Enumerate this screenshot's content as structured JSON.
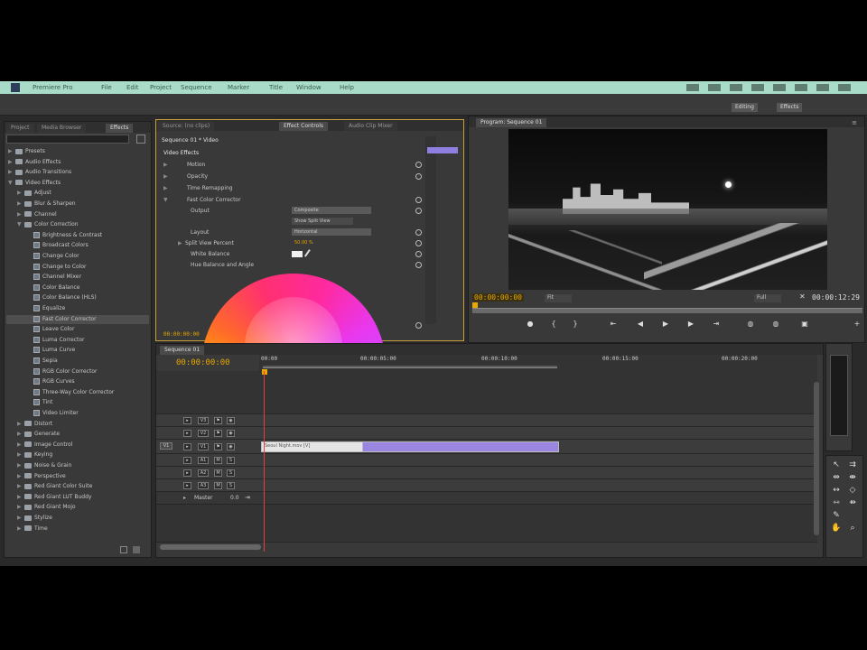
{
  "app": {
    "name": "Premiere Pro",
    "menu": [
      "File",
      "Edit",
      "Project",
      "Sequence",
      "Marker",
      "Title",
      "Window",
      "Help"
    ]
  },
  "workspace": {
    "buttons": [
      "Editing",
      "Effects"
    ]
  },
  "project_panel": {
    "tabs": [
      "Project",
      "Media Browser",
      "Effects"
    ],
    "search_placeholder": "",
    "items": [
      {
        "label": "Presets",
        "type": "folder",
        "depth": 0,
        "expanded": false
      },
      {
        "label": "Audio Effects",
        "type": "folder",
        "depth": 0,
        "expanded": false
      },
      {
        "label": "Audio Transitions",
        "type": "folder",
        "depth": 0,
        "expanded": false
      },
      {
        "label": "Video Effects",
        "type": "folder",
        "depth": 0,
        "expanded": true
      },
      {
        "label": "Adjust",
        "type": "folder",
        "depth": 1,
        "expanded": false
      },
      {
        "label": "Blur & Sharpen",
        "type": "folder",
        "depth": 1,
        "expanded": false
      },
      {
        "label": "Channel",
        "type": "folder",
        "depth": 1,
        "expanded": false
      },
      {
        "label": "Color Correction",
        "type": "folder",
        "depth": 1,
        "expanded": true
      },
      {
        "label": "Brightness & Contrast",
        "type": "effect",
        "depth": 2
      },
      {
        "label": "Broadcast Colors",
        "type": "effect",
        "depth": 2
      },
      {
        "label": "Change Color",
        "type": "effect",
        "depth": 2
      },
      {
        "label": "Change to Color",
        "type": "effect",
        "depth": 2
      },
      {
        "label": "Channel Mixer",
        "type": "effect",
        "depth": 2
      },
      {
        "label": "Color Balance",
        "type": "effect",
        "depth": 2
      },
      {
        "label": "Color Balance (HLS)",
        "type": "effect",
        "depth": 2
      },
      {
        "label": "Equalize",
        "type": "effect",
        "depth": 2
      },
      {
        "label": "Fast Color Corrector",
        "type": "effect",
        "depth": 2,
        "selected": true
      },
      {
        "label": "Leave Color",
        "type": "effect",
        "depth": 2
      },
      {
        "label": "Luma Corrector",
        "type": "effect",
        "depth": 2
      },
      {
        "label": "Luma Curve",
        "type": "effect",
        "depth": 2
      },
      {
        "label": "Sepia",
        "type": "effect",
        "depth": 2
      },
      {
        "label": "RGB Color Corrector",
        "type": "effect",
        "depth": 2
      },
      {
        "label": "RGB Curves",
        "type": "effect",
        "depth": 2
      },
      {
        "label": "Three-Way Color Corrector",
        "type": "effect",
        "depth": 2
      },
      {
        "label": "Tint",
        "type": "effect",
        "depth": 2
      },
      {
        "label": "Video Limiter",
        "type": "effect",
        "depth": 2
      },
      {
        "label": "Distort",
        "type": "folder",
        "depth": 1,
        "expanded": false
      },
      {
        "label": "Generate",
        "type": "folder",
        "depth": 1,
        "expanded": false
      },
      {
        "label": "Image Control",
        "type": "folder",
        "depth": 1,
        "expanded": false
      },
      {
        "label": "Keying",
        "type": "folder",
        "depth": 1,
        "expanded": false
      },
      {
        "label": "Noise & Grain",
        "type": "folder",
        "depth": 1,
        "expanded": false
      },
      {
        "label": "Perspective",
        "type": "folder",
        "depth": 1,
        "expanded": false
      },
      {
        "label": "Red Giant Color Suite",
        "type": "folder",
        "depth": 1,
        "expanded": false
      },
      {
        "label": "Red Giant LUT Buddy",
        "type": "folder",
        "depth": 1,
        "expanded": false
      },
      {
        "label": "Red Giant Mojo",
        "type": "folder",
        "depth": 1,
        "expanded": false
      },
      {
        "label": "Stylize",
        "type": "folder",
        "depth": 1,
        "expanded": false
      },
      {
        "label": "Time",
        "type": "folder",
        "depth": 1,
        "expanded": false
      }
    ]
  },
  "effect_controls": {
    "tabs": [
      "Source: (no clips)",
      "Effect Controls",
      "Audio Clip Mixer"
    ],
    "header": "Sequence 01 * Video",
    "section_label": "Video Effects",
    "rows": [
      {
        "label": "Motion",
        "indent": 1
      },
      {
        "label": "Opacity",
        "indent": 1
      },
      {
        "label": "Time Remapping",
        "indent": 1
      },
      {
        "label": "Fast Color Corrector",
        "indent": 1
      },
      {
        "label": "Output",
        "indent": 2
      },
      {
        "label": "Layout",
        "indent": 2
      },
      {
        "label": "Split View Percent",
        "indent": 2
      },
      {
        "label": "White Balance",
        "indent": 2
      },
      {
        "label": "Hue Balance and Angle",
        "indent": 2
      }
    ],
    "output_value": "Composite",
    "show_split_view": "Show Split View",
    "layout_value": "Horizontal",
    "split_percent": "50.00 %",
    "timecode": "00:00:00:00"
  },
  "program_monitor": {
    "title": "Program: Sequence 01",
    "timecode_in": "00:00:00:00",
    "fit": "Fit",
    "resolution": "Full",
    "timecode_out": "00:00:12:29",
    "controls": [
      "add-marker",
      "mark-in",
      "mark-out",
      "go-to-in",
      "step-back",
      "play",
      "step-forward",
      "go-to-out",
      "lift",
      "extract",
      "export-frame"
    ]
  },
  "timeline": {
    "title": "Sequence 01",
    "timecode": "00:00:00:00",
    "ruler": [
      "00:00",
      "00:00:05:00",
      "00:00:10:00",
      "00:00:15:00",
      "00:00:20:00"
    ],
    "tracks": [
      "V3",
      "V2",
      "V1",
      "A1",
      "A2",
      "A3"
    ],
    "master_label": "Master",
    "master_value": "0.0",
    "clip_label": "Seoul Night.mov [V]"
  },
  "colors": {
    "accent": "#e8a800",
    "playhead": "#e04040",
    "clip": "#9a86e0",
    "menubar": "#a9dcc8"
  }
}
